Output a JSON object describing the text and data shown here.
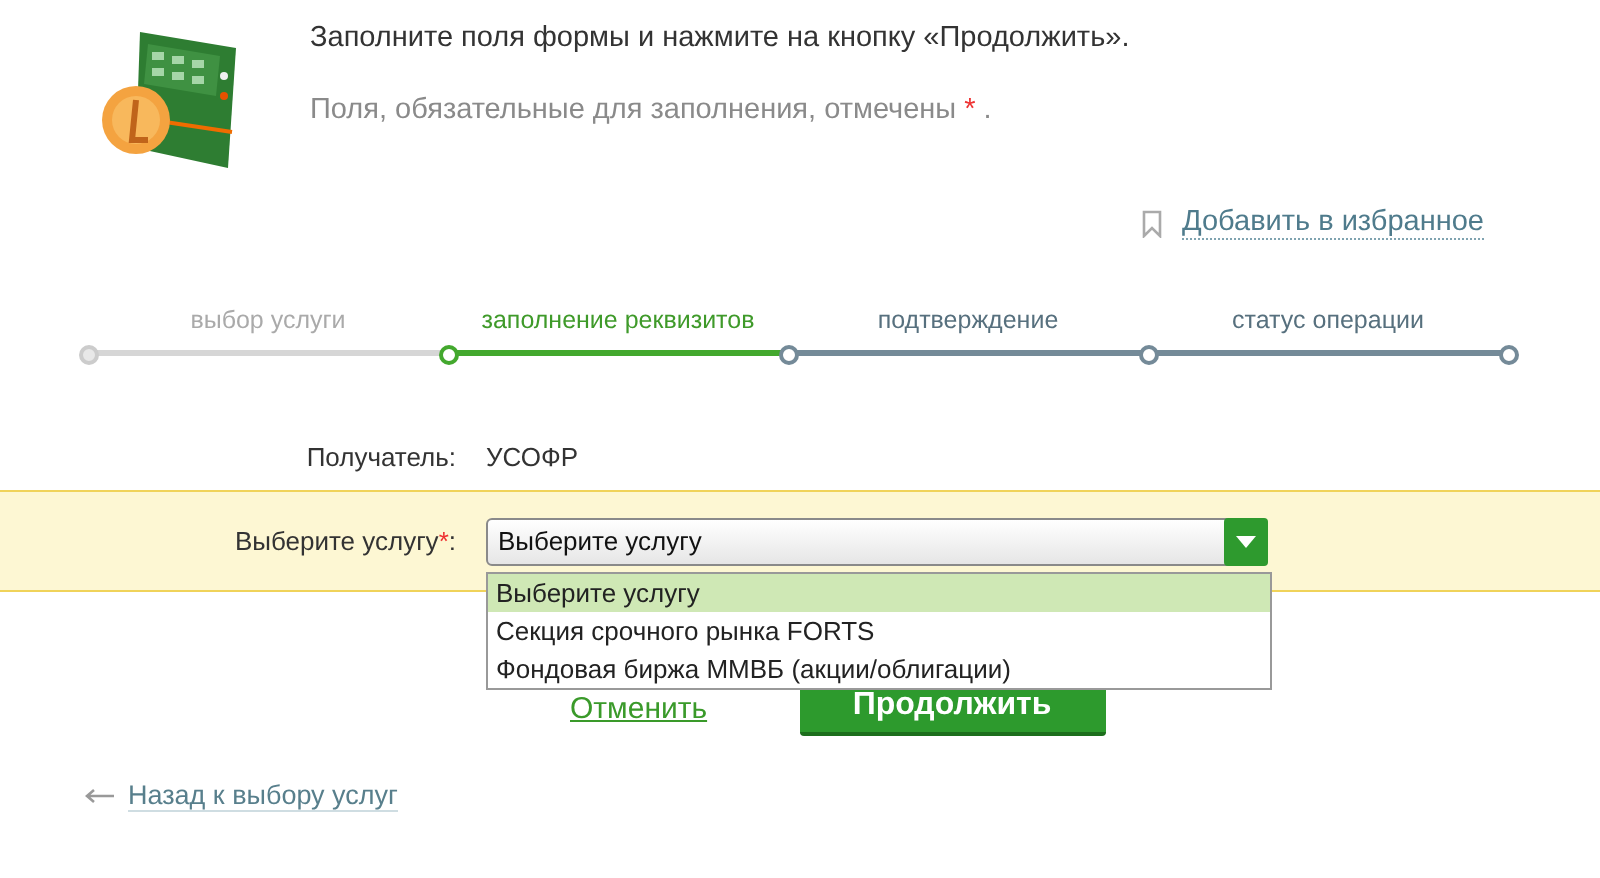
{
  "header": {
    "instruction": "Заполните поля формы и нажмите на кнопку «Продолжить».",
    "required_note": "Поля, обязательные для заполнения, отмечены",
    "required_mark": "*",
    "required_end": "."
  },
  "favorites_link": "Добавить в избранное",
  "steps": [
    {
      "label": "выбор услуги",
      "done": true,
      "selected": false
    },
    {
      "label": "заполнение реквизитов",
      "done": false,
      "selected": true
    },
    {
      "label": "подтверждение",
      "done": false,
      "selected": false
    },
    {
      "label": "статус операции",
      "done": false,
      "selected": false
    }
  ],
  "recipient": {
    "label": "Получатель:",
    "value": "УСОФР"
  },
  "service": {
    "label": "Выберите услугу",
    "required_mark": "*",
    "colon": ":",
    "value": "Выберите услугу",
    "expanded": true,
    "options": [
      {
        "label": "Выберите услугу",
        "selected": true
      },
      {
        "label": "Секция срочного рынка FORTS",
        "selected": false
      },
      {
        "label": "Фондовая биржа ММВБ (акции/облигации)",
        "selected": false
      }
    ]
  },
  "cancel_link": "Отменить",
  "continue_button": "Продолжить",
  "back_link": "Назад к выбору услуг"
}
